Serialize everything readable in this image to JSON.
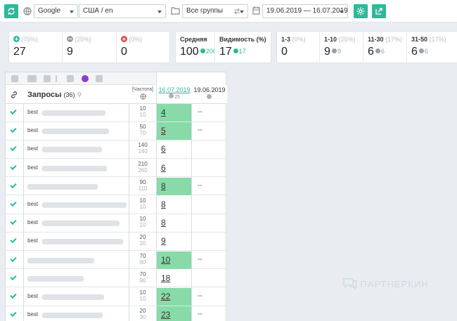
{
  "toolbar": {
    "search_engine": "Google",
    "region": "США / en",
    "groups": "Все группы",
    "date_range": "19.06.2019 — 16.07.2019",
    "colors": {
      "accent": "#2fb89a"
    }
  },
  "stats": {
    "up": {
      "pct": "(75%)",
      "value": "27"
    },
    "same": {
      "pct": "(25%)",
      "value": "9"
    },
    "down": {
      "pct": "(0%)",
      "value": "0"
    },
    "average": {
      "label": "Средняя",
      "value": "100",
      "delta": "200"
    },
    "visibility": {
      "label": "Видимость (%)",
      "value": "17",
      "delta": "17"
    },
    "range_1_3": {
      "label": "1-3",
      "pct": "(0%)",
      "value": "0"
    },
    "range_1_10": {
      "label": "1-10",
      "pct": "(25%)",
      "value": "9",
      "delta": "9"
    },
    "range_11_30": {
      "label": "11-30",
      "pct": "(17%)",
      "value": "6",
      "delta": "6"
    },
    "range_31_50": {
      "label": "31-50",
      "pct": "(17%)",
      "value": "6",
      "delta": "6"
    }
  },
  "table": {
    "queries_label": "Запросы",
    "queries_count": "(36)",
    "freq_header": "[Частота]",
    "date_current": "16.07.2019",
    "date_current_sub": "25",
    "date_prev": "19.06.2019",
    "rows": [
      {
        "query": "best",
        "freq": "10",
        "freq2": "10",
        "pos": "4",
        "prev": "--"
      },
      {
        "query": "best",
        "freq": "50",
        "freq2": "70",
        "pos": "5",
        "prev": "--"
      },
      {
        "query": "best",
        "freq": "140",
        "freq2": "140",
        "pos": "6",
        "prev": ""
      },
      {
        "query": "best",
        "freq": "210",
        "freq2": "260",
        "pos": "6",
        "prev": ""
      },
      {
        "query": "",
        "freq": "90",
        "freq2": "110",
        "pos": "8",
        "prev": "--"
      },
      {
        "query": "best",
        "freq": "10",
        "freq2": "10",
        "pos": "8",
        "prev": ""
      },
      {
        "query": "best",
        "freq": "10",
        "freq2": "10",
        "pos": "8",
        "prev": ""
      },
      {
        "query": "best",
        "freq": "20",
        "freq2": "20",
        "pos": "9",
        "prev": ""
      },
      {
        "query": "",
        "freq": "70",
        "freq2": "90",
        "pos": "10",
        "prev": "--"
      },
      {
        "query": "",
        "freq": "70",
        "freq2": "90",
        "pos": "18",
        "prev": ""
      },
      {
        "query": "best",
        "freq": "10",
        "freq2": "10",
        "pos": "22",
        "prev": "--"
      },
      {
        "query": "best",
        "freq": "20",
        "freq2": "30",
        "pos": "23",
        "prev": "--"
      }
    ]
  },
  "watermark": "ПАРТНЕРКИН"
}
